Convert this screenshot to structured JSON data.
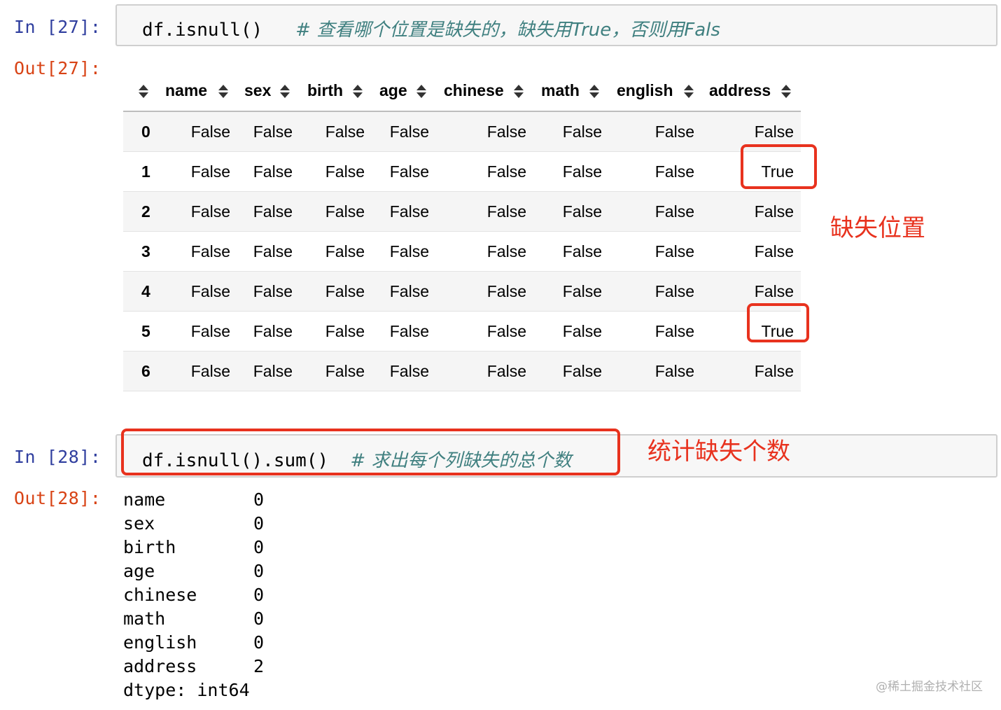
{
  "cell27": {
    "in_prompt": "In [27]:",
    "out_prompt": "Out[27]:",
    "code": "df.isnull()",
    "comment": "# 查看哪个位置是缺失的，缺失用True，否则用Fals"
  },
  "dataframe": {
    "columns": [
      "name",
      "sex",
      "birth",
      "age",
      "chinese",
      "math",
      "english",
      "address"
    ],
    "rows": [
      {
        "index": "0",
        "values": [
          "False",
          "False",
          "False",
          "False",
          "False",
          "False",
          "False",
          "False"
        ]
      },
      {
        "index": "1",
        "values": [
          "False",
          "False",
          "False",
          "False",
          "False",
          "False",
          "False",
          "True"
        ]
      },
      {
        "index": "2",
        "values": [
          "False",
          "False",
          "False",
          "False",
          "False",
          "False",
          "False",
          "False"
        ]
      },
      {
        "index": "3",
        "values": [
          "False",
          "False",
          "False",
          "False",
          "False",
          "False",
          "False",
          "False"
        ]
      },
      {
        "index": "4",
        "values": [
          "False",
          "False",
          "False",
          "False",
          "False",
          "False",
          "False",
          "False"
        ]
      },
      {
        "index": "5",
        "values": [
          "False",
          "False",
          "False",
          "False",
          "False",
          "False",
          "False",
          "True"
        ]
      },
      {
        "index": "6",
        "values": [
          "False",
          "False",
          "False",
          "False",
          "False",
          "False",
          "False",
          "False"
        ]
      }
    ]
  },
  "annotations": {
    "missing_position": "缺失位置",
    "count_missing": "统计缺失个数",
    "accent_color": "#e8321e"
  },
  "cell28": {
    "in_prompt": "In [28]:",
    "out_prompt": "Out[28]:",
    "code": "df.isnull().sum()",
    "comment": "# 求出每个列缺失的总个数",
    "series": [
      {
        "key": "name",
        "value": "0"
      },
      {
        "key": "sex",
        "value": "0"
      },
      {
        "key": "birth",
        "value": "0"
      },
      {
        "key": "age",
        "value": "0"
      },
      {
        "key": "chinese",
        "value": "0"
      },
      {
        "key": "math",
        "value": "0"
      },
      {
        "key": "english",
        "value": "0"
      },
      {
        "key": "address",
        "value": "2"
      }
    ],
    "dtype": "dtype: int64"
  },
  "watermark": "@稀土掘金技术社区"
}
